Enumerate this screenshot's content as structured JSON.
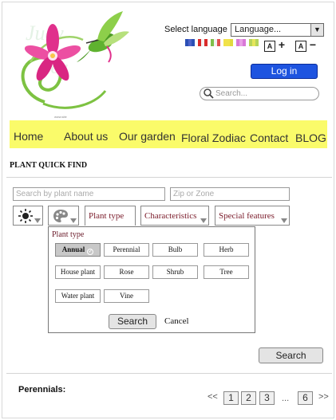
{
  "header": {
    "language_label": "Select language",
    "language_value": "Language...",
    "login_label": "Log in",
    "search_placeholder": "Search...",
    "font_increase": "+",
    "font_decrease": "−",
    "font_glyph": "A"
  },
  "nav": {
    "items": [
      "Home",
      "About us",
      "Our garden",
      "Floral Zodiac",
      "Contact",
      "BLOG"
    ]
  },
  "quick_find": {
    "title": "PLANT QUICK FIND",
    "plant_name_placeholder": "Search by plant name",
    "zip_placeholder": "Zip or Zone",
    "filters": [
      "Plant type",
      "Characteristics",
      "Special features"
    ]
  },
  "plant_type_panel": {
    "title": "Plant type",
    "options": [
      "Annual",
      "Perennial",
      "Bulb",
      "Herb",
      "House plant",
      "Rose",
      "Shrub",
      "Tree",
      "Water plant",
      "Vine"
    ],
    "selected": "Annual",
    "search_label": "Search",
    "cancel_label": "Cancel"
  },
  "search_button": "Search",
  "results": {
    "heading": "Perennials:",
    "pages": [
      "1",
      "2",
      "3",
      "6"
    ],
    "prev": "<<",
    "next": ">>",
    "ellipsis": "..."
  },
  "colors": {
    "nav_bg": "#fafb6a",
    "login_bg": "#1e54e0",
    "filter_text": "#7a1b2a"
  }
}
